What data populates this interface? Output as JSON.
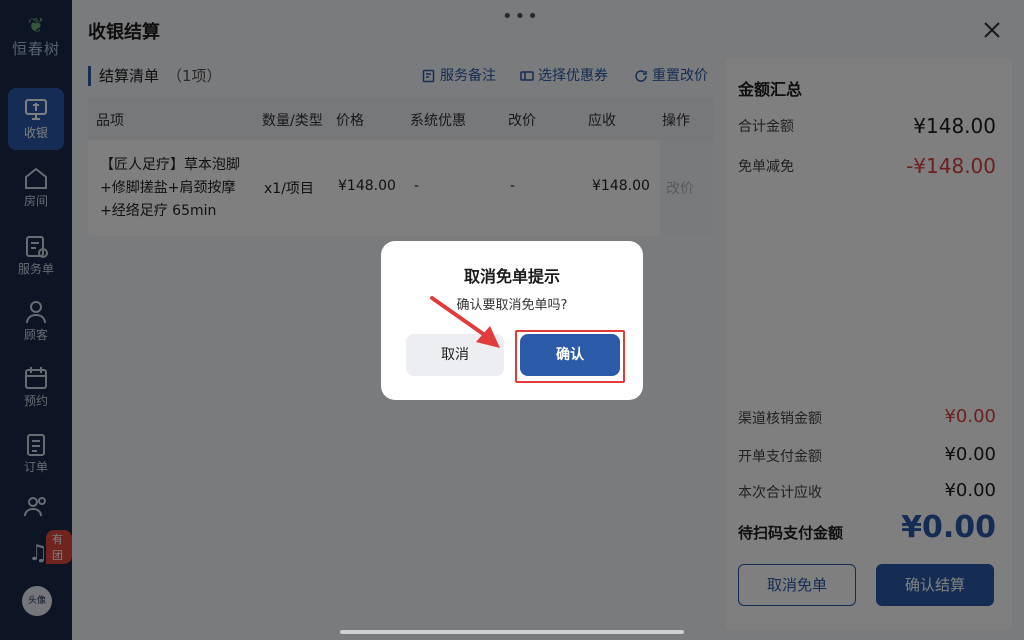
{
  "brand": {
    "logo_text": "恒春树"
  },
  "nav": [
    {
      "label": "收银",
      "icon": "cashier-monitor-icon",
      "active": true
    },
    {
      "label": "房间",
      "icon": "house-icon"
    },
    {
      "label": "服务单",
      "icon": "service-order-icon"
    },
    {
      "label": "顾客",
      "icon": "customer-icon"
    },
    {
      "label": "预约",
      "icon": "calendar-icon"
    },
    {
      "label": "订单",
      "icon": "order-clipboard-icon"
    },
    {
      "label": "",
      "icon": "staff-group-icon"
    }
  ],
  "rail_badge": "有团",
  "avatar_text": "头像",
  "header": {
    "title": "收银结算",
    "more_icon": "more-dots-icon",
    "close_icon": "close-icon"
  },
  "list": {
    "title": "结算清单",
    "count": "（1项）",
    "actions": [
      {
        "label": "服务备注",
        "icon": "note-edit-icon"
      },
      {
        "label": "选择优惠券",
        "icon": "coupon-icon"
      },
      {
        "label": "重置改价",
        "icon": "refresh-icon"
      }
    ],
    "columns": [
      "品项",
      "数量/类型",
      "价格",
      "系统优惠",
      "改价",
      "应收",
      "操作"
    ],
    "rows": [
      {
        "name_lines": [
          "【匠人足疗】草本泡脚",
          "+修脚搓盐+肩颈按摩",
          "+经络足疗 65min"
        ],
        "qty": "x1/项目",
        "price": "¥148.00",
        "system_discount": "-",
        "price_change": "-",
        "receivable": "¥148.00",
        "op": "改价"
      }
    ]
  },
  "summary": {
    "title": "金额汇总",
    "total_label": "合计金额",
    "total_value": "¥148.00",
    "waive_label": "免单减免",
    "waive_value": "-¥148.00",
    "channel_label": "渠道核销金额",
    "channel_value": "¥0.00",
    "open_label": "开单支付金额",
    "open_value": "¥0.00",
    "current_label": "本次合计应收",
    "current_value": "¥0.00",
    "pay_label": "待扫码支付金额",
    "pay_value": "¥0.00",
    "cancel_free_button": "取消免单",
    "confirm_checkout_button": "确认结算"
  },
  "dialog": {
    "title": "取消免单提示",
    "message": "确认要取消免单吗?",
    "cancel": "取消",
    "confirm": "确认"
  },
  "colors": {
    "primary": "#2b5aa8",
    "danger": "#d94040",
    "rail": "#1a2a4a",
    "annotation": "#e23b3b"
  }
}
